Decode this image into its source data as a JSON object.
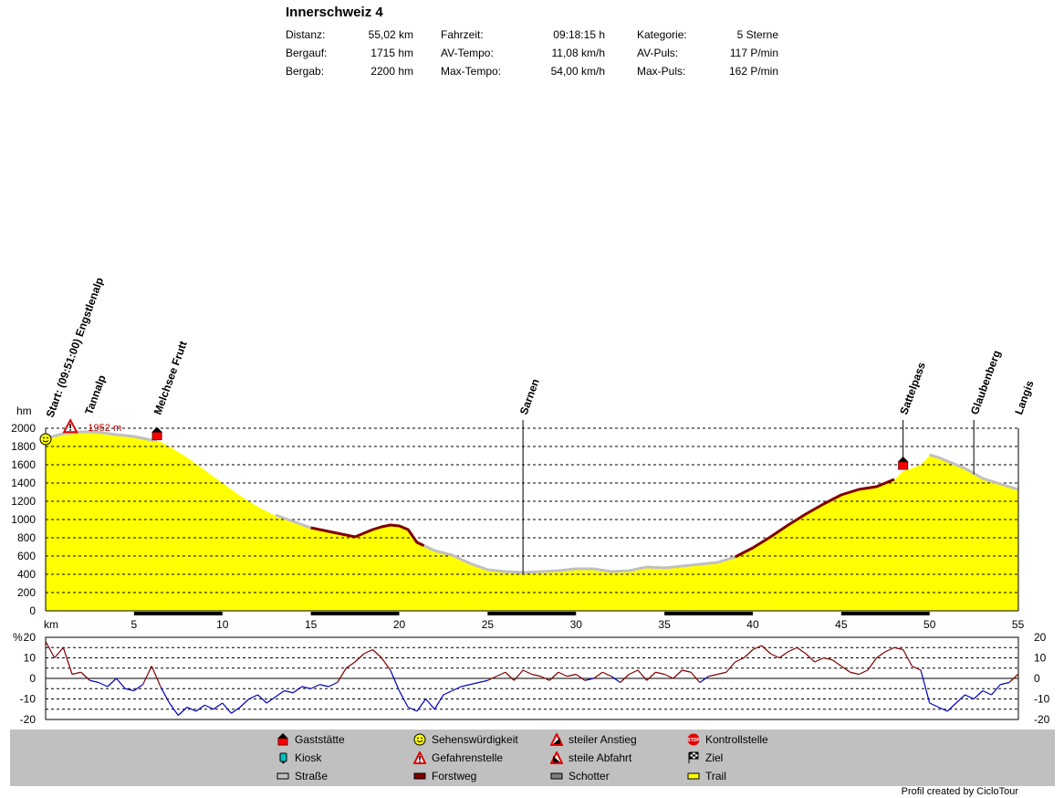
{
  "title": "Innerschweiz 4",
  "stats": [
    [
      {
        "label": "Distanz:",
        "value": "55,02 km"
      },
      {
        "label": "Fahrzeit:",
        "value": "09:18:15 h"
      },
      {
        "label": "Kategorie:",
        "value": "5 Sterne"
      }
    ],
    [
      {
        "label": "Bergauf:",
        "value": "1715 hm"
      },
      {
        "label": "AV-Tempo:",
        "value": "11,08 km/h"
      },
      {
        "label": "AV-Puls:",
        "value": "117 P/min"
      }
    ],
    [
      {
        "label": "Bergab:",
        "value": "2200 hm"
      },
      {
        "label": "Max-Tempo:",
        "value": "54,00 km/h"
      },
      {
        "label": "Max-Puls:",
        "value": "162 P/min"
      }
    ]
  ],
  "legend": [
    {
      "icon": "inn-icon",
      "label": "Gaststätte"
    },
    {
      "icon": "smiley-icon",
      "label": "Sehenswürdigkeit"
    },
    {
      "icon": "steep-climb-icon",
      "label": "steiler Anstieg"
    },
    {
      "icon": "stop-icon",
      "label": "Kontrollstelle"
    },
    {
      "icon": "kiosk-icon",
      "label": "Kiosk"
    },
    {
      "icon": "danger-icon",
      "label": "Gefahrenstelle"
    },
    {
      "icon": "steep-descent-icon",
      "label": "steile Abfahrt"
    },
    {
      "icon": "finish-flag-icon",
      "label": "Ziel"
    },
    {
      "icon": "road-swatch-icon",
      "label": "Straße"
    },
    {
      "icon": "forest-road-swatch-icon",
      "label": "Forstweg"
    },
    {
      "icon": "gravel-swatch-icon",
      "label": "Schotter"
    },
    {
      "icon": "trail-swatch-icon",
      "label": "Trail"
    }
  ],
  "credit": "Profil created by CicloTour",
  "colors": {
    "trail": "#ffff00",
    "road": "#c0c0c0",
    "forest": "#800000",
    "gravel": "#808080",
    "grade_up": "#800000",
    "grade_down": "#0000c0",
    "legend_bg": "#c0c0c0"
  },
  "chart_data": [
    {
      "type": "area",
      "ylabel": "hm",
      "xlabel": "km",
      "xlim": [
        0,
        55.02
      ],
      "ylim": [
        0,
        2000
      ],
      "x_ticks": [
        5,
        10,
        15,
        20,
        25,
        30,
        35,
        40,
        45,
        50,
        55
      ],
      "y_ticks": [
        0,
        200,
        400,
        600,
        800,
        1000,
        1200,
        1400,
        1600,
        1800,
        2000
      ],
      "grid": "dashed horizontal",
      "peak_label": "1952 m",
      "peak_km": 2.5,
      "peak_value": 1952,
      "waypoints": [
        {
          "km": 0,
          "name": "Start: (09:51:00) Engstlenalp",
          "icon": "smiley-icon"
        },
        {
          "km": 2.4,
          "name": "Tannalp",
          "icon": "danger-icon",
          "icon_km": 1.4
        },
        {
          "km": 6.3,
          "name": "Melchsee Frutt",
          "icon": "inn-icon"
        },
        {
          "km": 27.0,
          "name": "Sarnen"
        },
        {
          "km": 48.5,
          "name": "Sattelpass",
          "icon": "inn-icon"
        },
        {
          "km": 52.5,
          "name": "Glaubenberg"
        },
        {
          "km": 55.0,
          "name": "Langis"
        }
      ],
      "series": [
        {
          "name": "Höhe",
          "x": [
            0,
            1,
            2,
            2.5,
            3,
            4,
            5,
            6,
            6.5,
            7,
            8,
            9,
            10,
            11,
            12,
            13,
            14,
            15,
            16,
            17,
            17.5,
            18,
            18.5,
            19,
            19.5,
            20,
            20.5,
            21,
            22,
            23,
            24,
            25,
            26,
            27,
            28,
            29,
            30,
            31,
            32,
            33,
            34,
            35,
            36,
            37,
            38,
            39,
            40,
            41,
            42,
            43,
            44,
            45,
            46,
            47,
            48,
            48.5,
            49,
            49.5,
            50,
            50.5,
            51,
            52,
            53,
            54,
            55
          ],
          "values": [
            1880,
            1930,
            1950,
            1952,
            1945,
            1920,
            1900,
            1860,
            1850,
            1800,
            1680,
            1540,
            1400,
            1260,
            1140,
            1040,
            970,
            900,
            860,
            820,
            800,
            840,
            880,
            910,
            930,
            920,
            880,
            740,
            650,
            600,
            510,
            440,
            420,
            410,
            420,
            430,
            450,
            450,
            420,
            430,
            470,
            460,
            480,
            500,
            520,
            580,
            680,
            800,
            930,
            1050,
            1160,
            1260,
            1320,
            1350,
            1430,
            1530,
            1560,
            1600,
            1700,
            1670,
            1630,
            1550,
            1440,
            1380,
            1320
          ],
          "surface_segments": [
            {
              "from": 0,
              "to": 6.3,
              "surface": "road"
            },
            {
              "from": 6.3,
              "to": 13,
              "surface": "trail"
            },
            {
              "from": 13,
              "to": 15,
              "surface": "road"
            },
            {
              "from": 15,
              "to": 21.4,
              "surface": "forest"
            },
            {
              "from": 21.4,
              "to": 39,
              "surface": "road"
            },
            {
              "from": 39,
              "to": 48,
              "surface": "forest"
            },
            {
              "from": 48,
              "to": 50,
              "surface": "trail"
            },
            {
              "from": 50,
              "to": 55.02,
              "surface": "road"
            }
          ]
        }
      ]
    },
    {
      "type": "line",
      "ylabel": "%",
      "xlim": [
        0,
        55.02
      ],
      "ylim": [
        -20,
        20
      ],
      "y_ticks": [
        -20,
        -10,
        0,
        10,
        20
      ],
      "grid": "dashed horizontal",
      "series": [
        {
          "name": "Steigung",
          "x": [
            0,
            0.5,
            1,
            1.5,
            2,
            2.5,
            3,
            3.5,
            4,
            4.5,
            5,
            5.5,
            6,
            6.5,
            7,
            7.5,
            8,
            8.5,
            9,
            9.5,
            10,
            10.5,
            11,
            11.5,
            12,
            12.5,
            13,
            13.5,
            14,
            14.5,
            15,
            15.5,
            16,
            16.5,
            17,
            17.5,
            18,
            18.5,
            19,
            19.5,
            20,
            20.5,
            21,
            21.5,
            22,
            22.5,
            23,
            23.5,
            24,
            24.5,
            25,
            25.5,
            26,
            26.5,
            27,
            27.5,
            28,
            28.5,
            29,
            29.5,
            30,
            30.5,
            31,
            31.5,
            32,
            32.5,
            33,
            33.5,
            34,
            34.5,
            35,
            35.5,
            36,
            36.5,
            37,
            37.5,
            38,
            38.5,
            39,
            39.5,
            40,
            40.5,
            41,
            41.5,
            42,
            42.5,
            43,
            43.5,
            44,
            44.5,
            45,
            45.5,
            46,
            46.5,
            47,
            47.5,
            48,
            48.5,
            49,
            49.5,
            50,
            50.5,
            51,
            51.5,
            52,
            52.5,
            53,
            53.5,
            54,
            54.5,
            55
          ],
          "values": [
            18,
            10,
            15,
            2,
            3,
            -1,
            -2,
            -4,
            0,
            -5,
            -6,
            -3,
            6,
            -4,
            -12,
            -18,
            -14,
            -16,
            -13,
            -15,
            -12,
            -17,
            -14,
            -10,
            -8,
            -12,
            -9,
            -6,
            -7,
            -4,
            -5,
            -3,
            -4,
            -2,
            5,
            8,
            12,
            14,
            10,
            4,
            -6,
            -14,
            -16,
            -10,
            -15,
            -8,
            -6,
            -4,
            -3,
            -2,
            -1,
            1,
            3,
            -1,
            4,
            2,
            1,
            -1,
            3,
            1,
            2,
            -1,
            0,
            3,
            1,
            -2,
            2,
            4,
            -1,
            3,
            2,
            0,
            4,
            3,
            -2,
            1,
            2,
            3,
            8,
            10,
            14,
            16,
            12,
            10,
            13,
            15,
            12,
            8,
            10,
            9,
            6,
            3,
            2,
            4,
            10,
            13,
            15,
            14,
            6,
            4,
            -12,
            -14,
            -16,
            -12,
            -8,
            -10,
            -6,
            -8,
            -3,
            -2,
            2
          ]
        }
      ]
    }
  ]
}
